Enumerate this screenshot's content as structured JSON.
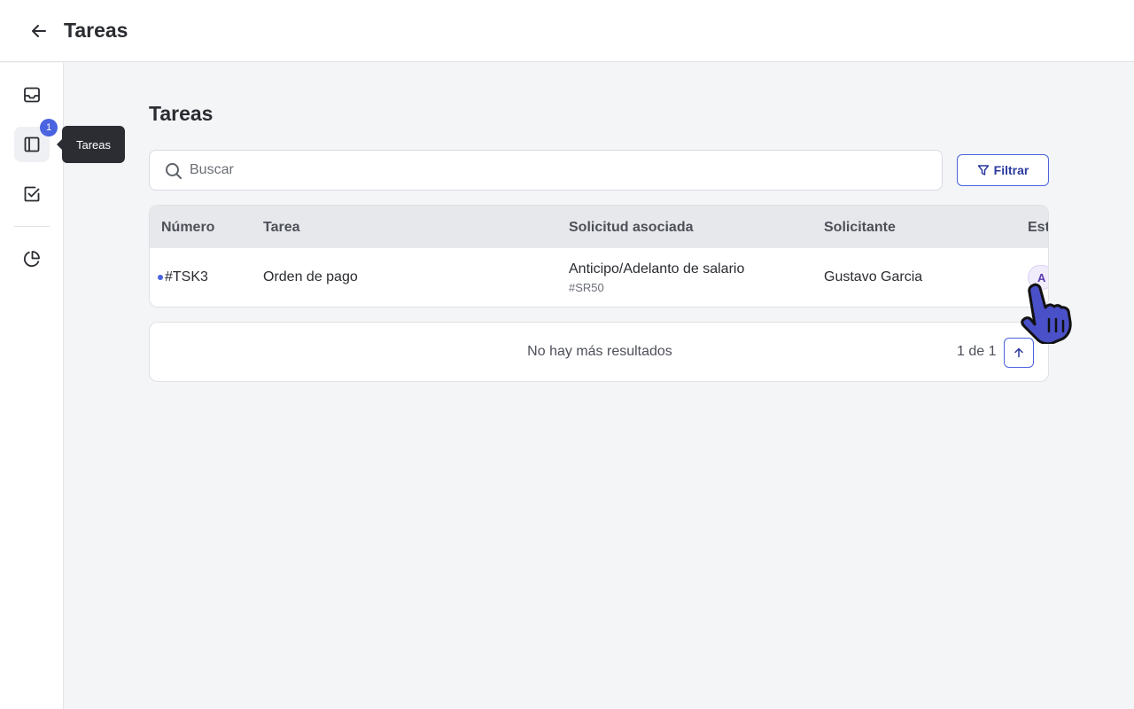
{
  "header": {
    "title": "Tareas",
    "back_icon": "arrow-left-icon"
  },
  "sidebar": {
    "items": [
      {
        "icon": "inbox-icon"
      },
      {
        "icon": "book-open-icon",
        "badge": "1",
        "active": true
      },
      {
        "icon": "check-square-icon"
      },
      {
        "icon": "pie-chart-icon"
      }
    ],
    "tooltip": "Tareas"
  },
  "main": {
    "title": "Tareas",
    "search": {
      "placeholder": "Buscar",
      "value": ""
    },
    "filter_label": "Filtrar",
    "table": {
      "columns": [
        "Número",
        "Tarea",
        "Solicitud asociada",
        "Solicitante",
        "Est"
      ],
      "rows": [
        {
          "number": "#TSK3",
          "task": "Orden de pago",
          "request": "Anticipo/Adelanto de salario",
          "request_id": "#SR50",
          "requester": "Gustavo Garcia",
          "status": "A"
        }
      ]
    },
    "footer": {
      "message": "No hay más resultados",
      "pagination": "1 de 1"
    }
  },
  "colors": {
    "accent": "#4a63e0",
    "tooltip_bg": "#2b2d33",
    "page_bg": "#f4f5f7"
  }
}
